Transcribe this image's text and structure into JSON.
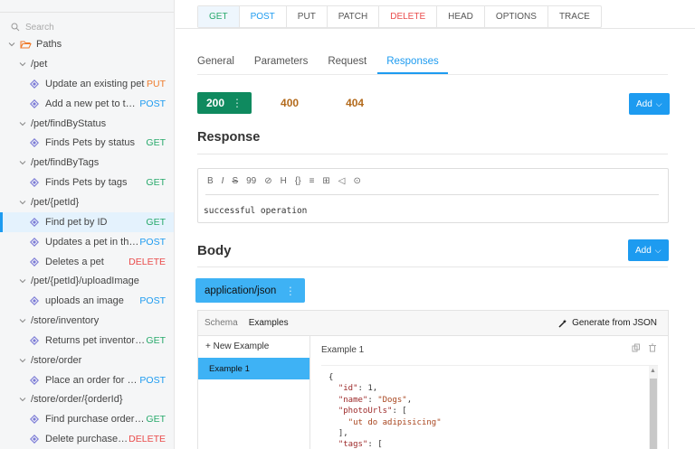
{
  "sidebar": {
    "search_placeholder": "Search",
    "root_folder": "Paths",
    "rows": [
      {
        "type": "group",
        "label": "/pet"
      },
      {
        "type": "op",
        "label": "Update an existing pet",
        "method": "PUT",
        "color": "#ef7b2c"
      },
      {
        "type": "op",
        "label": "Add a new pet to the ...",
        "method": "POST",
        "color": "#1d9bf0"
      },
      {
        "type": "group",
        "label": "/pet/findByStatus"
      },
      {
        "type": "op",
        "label": "Finds Pets by status",
        "method": "GET",
        "color": "#27a96b"
      },
      {
        "type": "group",
        "label": "/pet/findByTags"
      },
      {
        "type": "op",
        "label": "Finds Pets by tags",
        "method": "GET",
        "color": "#27a96b"
      },
      {
        "type": "group",
        "label": "/pet/{petId}"
      },
      {
        "type": "op",
        "label": "Find pet by ID",
        "method": "GET",
        "color": "#27a96b",
        "active": true
      },
      {
        "type": "op",
        "label": "Updates a pet in the ...",
        "method": "POST",
        "color": "#1d9bf0"
      },
      {
        "type": "op",
        "label": "Deletes a pet",
        "method": "DELETE",
        "color": "#ea4c4c"
      },
      {
        "type": "group",
        "label": "/pet/{petId}/uploadImage"
      },
      {
        "type": "op",
        "label": "uploads an image",
        "method": "POST",
        "color": "#1d9bf0"
      },
      {
        "type": "group",
        "label": "/store/inventory"
      },
      {
        "type": "op",
        "label": "Returns pet inventorie...",
        "method": "GET",
        "color": "#27a96b"
      },
      {
        "type": "group",
        "label": "/store/order"
      },
      {
        "type": "op",
        "label": "Place an order for a p...",
        "method": "POST",
        "color": "#1d9bf0"
      },
      {
        "type": "group",
        "label": "/store/order/{orderId}"
      },
      {
        "type": "op",
        "label": "Find purchase order b...",
        "method": "GET",
        "color": "#27a96b"
      },
      {
        "type": "op",
        "label": "Delete purchase or...",
        "method": "DELETE",
        "color": "#ea4c4c"
      }
    ]
  },
  "method_tabs": [
    {
      "label": "GET",
      "color": "#27a96b",
      "active": true
    },
    {
      "label": "POST",
      "color": "#1d9bf0"
    },
    {
      "label": "PUT",
      "color": "#555555"
    },
    {
      "label": "PATCH",
      "color": "#555555"
    },
    {
      "label": "DELETE",
      "color": "#ea4c4c"
    },
    {
      "label": "HEAD",
      "color": "#555555"
    },
    {
      "label": "OPTIONS",
      "color": "#555555"
    },
    {
      "label": "TRACE",
      "color": "#555555"
    }
  ],
  "sub_tabs": {
    "general": "General",
    "parameters": "Parameters",
    "request": "Request",
    "responses": "Responses"
  },
  "status_codes": {
    "active": "200",
    "active_menu": "⋮",
    "others": [
      "400",
      "404"
    ]
  },
  "add_label": "Add",
  "response": {
    "title": "Response",
    "toolbar": [
      "B",
      "I",
      "S",
      "99",
      "⊘",
      "H",
      "{}",
      "≡",
      "⊞",
      "◁",
      "⊙"
    ],
    "description": "successful operation"
  },
  "body": {
    "title": "Body",
    "content_type": "application/json",
    "content_type_menu": "⋮",
    "tabs": {
      "schema": "Schema",
      "examples": "Examples"
    },
    "generate_label": "Generate from JSON",
    "new_example_label": "+ New Example",
    "examples": [
      "Example 1"
    ],
    "current_example": "Example 1"
  },
  "code_lines": [
    [
      {
        "t": "{",
        "c": "p"
      }
    ],
    [
      {
        "t": "  ",
        "c": "p"
      },
      {
        "t": "\"id\"",
        "c": "k"
      },
      {
        "t": ": 1,",
        "c": "p"
      }
    ],
    [
      {
        "t": "  ",
        "c": "p"
      },
      {
        "t": "\"name\"",
        "c": "k"
      },
      {
        "t": ": ",
        "c": "p"
      },
      {
        "t": "\"Dogs\"",
        "c": "s"
      },
      {
        "t": ",",
        "c": "p"
      }
    ],
    [
      {
        "t": "  ",
        "c": "p"
      },
      {
        "t": "\"photoUrls\"",
        "c": "k"
      },
      {
        "t": ": [",
        "c": "p"
      }
    ],
    [
      {
        "t": "    ",
        "c": "p"
      },
      {
        "t": "\"ut do adipisicing\"",
        "c": "s"
      }
    ],
    [
      {
        "t": "  ],",
        "c": "p"
      }
    ],
    [
      {
        "t": "  ",
        "c": "p"
      },
      {
        "t": "\"tags\"",
        "c": "k"
      },
      {
        "t": ": [",
        "c": "p"
      }
    ]
  ]
}
